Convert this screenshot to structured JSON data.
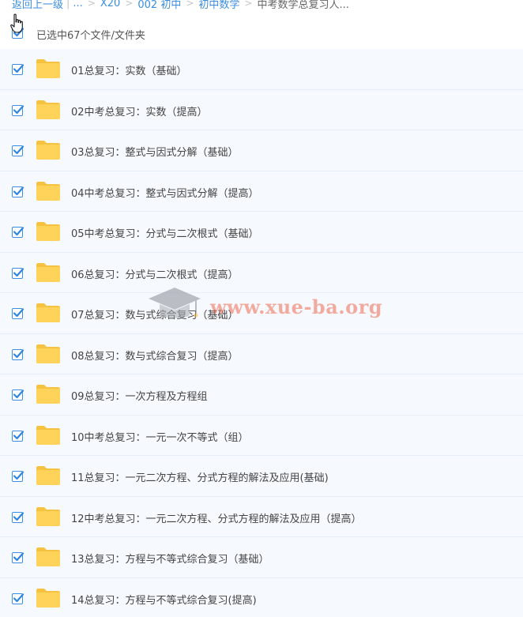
{
  "breadcrumb": {
    "back": "返回上一级",
    "ellipsis": "...",
    "items": [
      "X20",
      "002 初中",
      "初中数学",
      "中考数学总复习人..."
    ]
  },
  "selection": {
    "label": "已选中67个文件/文件夹",
    "checked": true
  },
  "files": [
    {
      "name": "01总复习：实数（基础）"
    },
    {
      "name": "02中考总复习：实数（提高）"
    },
    {
      "name": "03总复习：整式与因式分解（基础）"
    },
    {
      "name": "04中考总复习：整式与因式分解（提高）"
    },
    {
      "name": "05中考总复习：分式与二次根式（基础）"
    },
    {
      "name": "06总复习：分式与二次根式（提高）"
    },
    {
      "name": "07总复习：数与式综合复习（基础）"
    },
    {
      "name": "08总复习：数与式综合复习（提高）"
    },
    {
      "name": "09总复习：一次方程及方程组"
    },
    {
      "name": "10中考总复习：一元一次不等式（组）"
    },
    {
      "name": "11总复习：一元二次方程、分式方程的解法及应用(基础)"
    },
    {
      "name": "12中考总复习：一元二次方程、分式方程的解法及应用（提高）"
    },
    {
      "name": "13总复习：方程与不等式综合复习（基础）"
    },
    {
      "name": "14总复习：方程与不等式综合复习(提高)"
    }
  ],
  "watermark": {
    "text": "www.xue-ba.org"
  },
  "colors": {
    "link": "#3c8ee0",
    "checkbox": "#3b8ee6",
    "folder": "#ffd35a",
    "row_bg": "#f6f9fd",
    "watermark": "#f26a52"
  },
  "icons": {
    "checkbox": "checkmark-icon",
    "folder": "folder-icon",
    "cursor": "hand-pointer-icon",
    "watermark": "graduation-cap-icon"
  }
}
